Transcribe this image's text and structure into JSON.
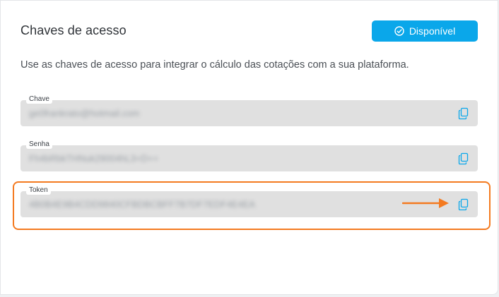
{
  "panel": {
    "title": "Chaves de acesso",
    "status_button": {
      "label": "Disponível",
      "icon": "check-circle-icon",
      "color": "#0aa7ea"
    },
    "description": "Use as chaves de acesso para integrar o cálculo das cotações com a sua plataforma."
  },
  "fields": [
    {
      "label": "Chave",
      "value": "ge0frankrato@hotmail.com",
      "icon": "copy-icon"
    },
    {
      "label": "Senha",
      "value": "Fh4bRbkTHNuk29004hL3+D++",
      "icon": "copy-icon"
    },
    {
      "label": "Token",
      "value": "4B0B4E9B4CDD9840CFBDBCBFF7B7DF7EDF4E4EA",
      "icon": "copy-icon"
    }
  ],
  "annotation": {
    "highlight_color": "#f47a20",
    "arrow": "arrow-right-icon"
  }
}
